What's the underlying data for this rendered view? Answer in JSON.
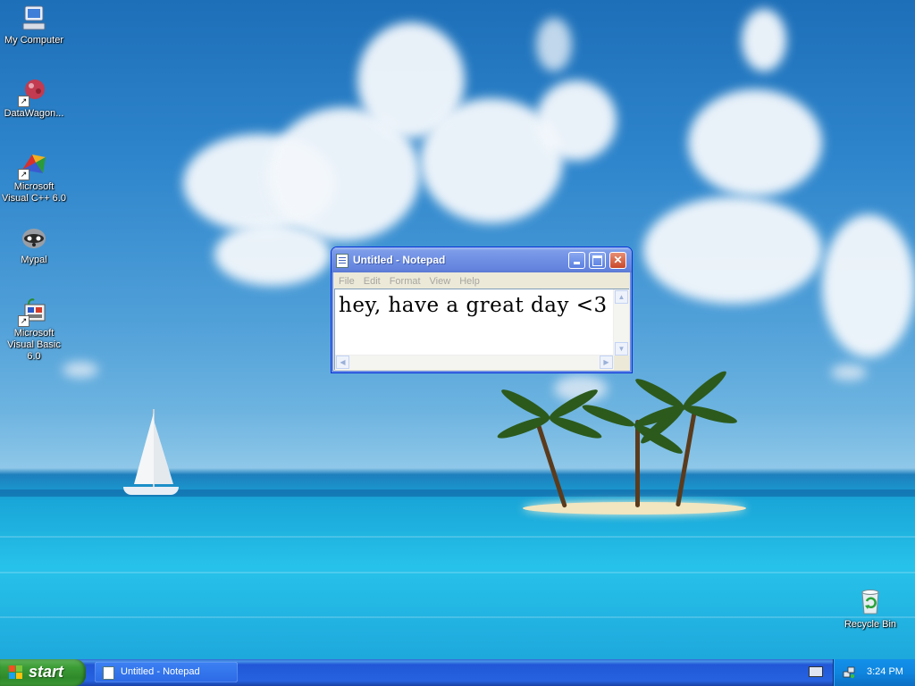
{
  "desktop": {
    "icons": [
      {
        "label": "My Computer"
      },
      {
        "label": "DataWagon..."
      },
      {
        "label": "Microsoft Visual C++ 6.0"
      },
      {
        "label": "Mypal"
      },
      {
        "label": "Microsoft Visual Basic 6.0"
      },
      {
        "label": "Recycle Bin"
      }
    ]
  },
  "notepad": {
    "title": "Untitled - Notepad",
    "menu": [
      "File",
      "Edit",
      "Format",
      "View",
      "Help"
    ],
    "content": "hey, have a great day <3"
  },
  "taskbar": {
    "start_label": "start",
    "tasks": [
      {
        "label": "Untitled - Notepad"
      }
    ],
    "clock": "3:24 PM"
  }
}
